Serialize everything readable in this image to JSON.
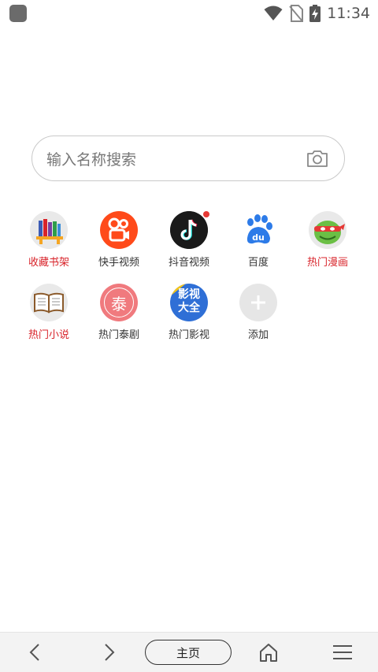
{
  "status_bar": {
    "time": "11:34",
    "icons": [
      "app-notification-icon",
      "wifi-icon",
      "no-sim-icon",
      "battery-charging-icon"
    ]
  },
  "search": {
    "placeholder": "输入名称搜索",
    "camera_icon": "camera-icon"
  },
  "shortcuts": [
    {
      "label": "收藏书架",
      "icon": "bookshelf-icon",
      "label_color": "#d8232a"
    },
    {
      "label": "快手视频",
      "icon": "kuaishou-icon",
      "label_color": "#333333"
    },
    {
      "label": "抖音视频",
      "icon": "douyin-icon",
      "label_color": "#333333"
    },
    {
      "label": "百度",
      "icon": "baidu-icon",
      "label_color": "#333333"
    },
    {
      "label": "热门漫画",
      "icon": "turtle-comic-icon",
      "label_color": "#d8232a"
    },
    {
      "label": "热门小说",
      "icon": "open-book-icon",
      "label_color": "#d8232a"
    },
    {
      "label": "热门泰剧",
      "icon": "thai-drama-icon",
      "icon_text": "泰",
      "label_color": "#333333"
    },
    {
      "label": "热门影视",
      "icon": "movies-icon",
      "icon_text": "影视大全",
      "label_color": "#333333"
    },
    {
      "label": "添加",
      "icon": "add-icon",
      "label_color": "#333333"
    }
  ],
  "bottom_bar": {
    "home_label": "主页",
    "icons": [
      "back-icon",
      "forward-icon",
      "home-icon",
      "menu-icon"
    ]
  }
}
